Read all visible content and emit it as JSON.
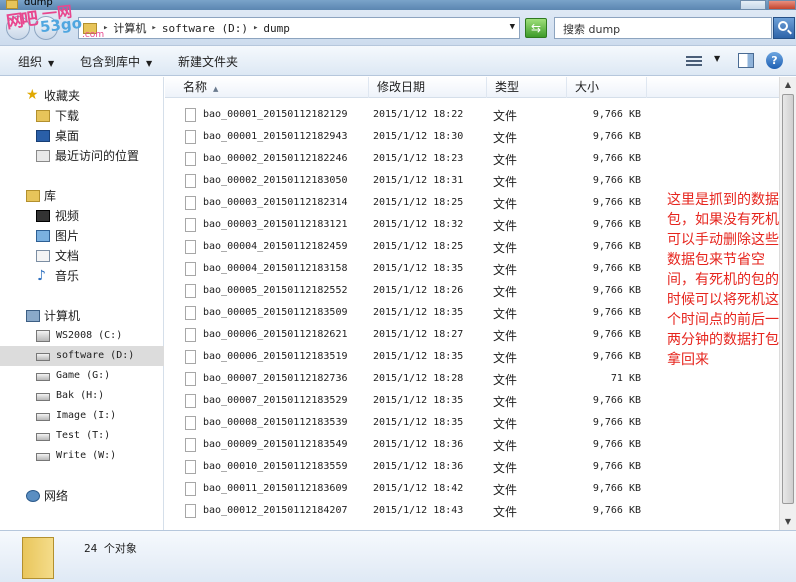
{
  "window": {
    "title": "dump"
  },
  "address": {
    "crumbs": [
      "计算机",
      "software (D:)",
      "dump"
    ]
  },
  "search": {
    "placeholder": "搜索 dump"
  },
  "watermark": {
    "text1": "网吧",
    "text2": "一网",
    "text3": "53go",
    "text4": ".com"
  },
  "toolbar": {
    "organize": "组织",
    "include_library": "包含到库中",
    "new_folder": "新建文件夹",
    "help": "?"
  },
  "nav": {
    "favorites": "收藏夹",
    "downloads": "下载",
    "desktop": "桌面",
    "recent": "最近访问的位置",
    "libraries": "库",
    "videos": "视频",
    "pictures": "图片",
    "documents": "文档",
    "music": "音乐",
    "computer": "计算机",
    "drives": [
      "WS2008 (C:)",
      "software (D:)",
      "Game (G:)",
      "Bak (H:)",
      "Image (I:)",
      "Test (T:)",
      "Write (W:)"
    ],
    "network": "网络"
  },
  "columns": {
    "name": "名称",
    "date": "修改日期",
    "type": "类型",
    "size": "大小"
  },
  "files": [
    {
      "name": "bao_00001_20150112182129",
      "date": "2015/1/12 18:22",
      "type": "文件",
      "size": "9,766 KB"
    },
    {
      "name": "bao_00001_20150112182943",
      "date": "2015/1/12 18:30",
      "type": "文件",
      "size": "9,766 KB"
    },
    {
      "name": "bao_00002_20150112182246",
      "date": "2015/1/12 18:23",
      "type": "文件",
      "size": "9,766 KB"
    },
    {
      "name": "bao_00002_20150112183050",
      "date": "2015/1/12 18:31",
      "type": "文件",
      "size": "9,766 KB"
    },
    {
      "name": "bao_00003_20150112182314",
      "date": "2015/1/12 18:25",
      "type": "文件",
      "size": "9,766 KB"
    },
    {
      "name": "bao_00003_20150112183121",
      "date": "2015/1/12 18:32",
      "type": "文件",
      "size": "9,766 KB"
    },
    {
      "name": "bao_00004_20150112182459",
      "date": "2015/1/12 18:25",
      "type": "文件",
      "size": "9,766 KB"
    },
    {
      "name": "bao_00004_20150112183158",
      "date": "2015/1/12 18:35",
      "type": "文件",
      "size": "9,766 KB"
    },
    {
      "name": "bao_00005_20150112182552",
      "date": "2015/1/12 18:26",
      "type": "文件",
      "size": "9,766 KB"
    },
    {
      "name": "bao_00005_20150112183509",
      "date": "2015/1/12 18:35",
      "type": "文件",
      "size": "9,766 KB"
    },
    {
      "name": "bao_00006_20150112182621",
      "date": "2015/1/12 18:27",
      "type": "文件",
      "size": "9,766 KB"
    },
    {
      "name": "bao_00006_20150112183519",
      "date": "2015/1/12 18:35",
      "type": "文件",
      "size": "9,766 KB"
    },
    {
      "name": "bao_00007_20150112182736",
      "date": "2015/1/12 18:28",
      "type": "文件",
      "size": "71 KB"
    },
    {
      "name": "bao_00007_20150112183529",
      "date": "2015/1/12 18:35",
      "type": "文件",
      "size": "9,766 KB"
    },
    {
      "name": "bao_00008_20150112183539",
      "date": "2015/1/12 18:35",
      "type": "文件",
      "size": "9,766 KB"
    },
    {
      "name": "bao_00009_20150112183549",
      "date": "2015/1/12 18:36",
      "type": "文件",
      "size": "9,766 KB"
    },
    {
      "name": "bao_00010_20150112183559",
      "date": "2015/1/12 18:36",
      "type": "文件",
      "size": "9,766 KB"
    },
    {
      "name": "bao_00011_20150112183609",
      "date": "2015/1/12 18:42",
      "type": "文件",
      "size": "9,766 KB"
    },
    {
      "name": "bao_00012_20150112184207",
      "date": "2015/1/12 18:43",
      "type": "文件",
      "size": "9,766 KB"
    }
  ],
  "annotation": "这里是抓到的数据包，如果没有死机可以手动删除这些数据包来节省空间，有死机的包的时候可以将死机这个时间点的前后一两分钟的数据打包拿回来",
  "status": {
    "count": "24 个对象"
  }
}
